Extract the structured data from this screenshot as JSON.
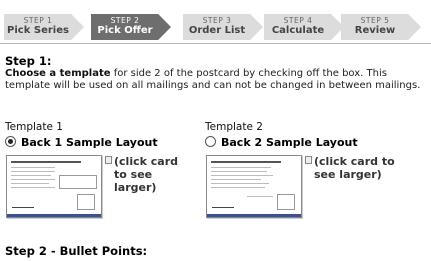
{
  "wizard": {
    "steps": [
      {
        "num": "STEP 1",
        "label": "Pick Series",
        "active": false
      },
      {
        "num": "STEP 2",
        "label": "Pick Offer",
        "active": true
      },
      {
        "num": "STEP 3",
        "label": "Order List",
        "active": false
      },
      {
        "num": "STEP 4",
        "label": "Calculate",
        "active": false
      },
      {
        "num": "STEP 5",
        "label": "Review",
        "active": false
      }
    ]
  },
  "step1": {
    "heading": "Step 1:",
    "instruction_bold": "Choose a template",
    "instruction_rest": " for side 2 of the postcard by checking off the box. This template will be used on all mailings and can not be changed in between mailings."
  },
  "templates": [
    {
      "title": "Template 1",
      "option_label": "Back 1 Sample Layout",
      "selected": true,
      "hint": "(click card to see larger)"
    },
    {
      "title": "Template 2",
      "option_label": "Back 2 Sample Layout",
      "selected": false,
      "hint": "(click card to see larger)"
    }
  ],
  "step2": {
    "heading": "Step 2 - Bullet Points:"
  },
  "colors": {
    "active_step": "#6e6e6e",
    "inactive_step": "#dcdcdc",
    "card_band": "#3a4fa0"
  }
}
